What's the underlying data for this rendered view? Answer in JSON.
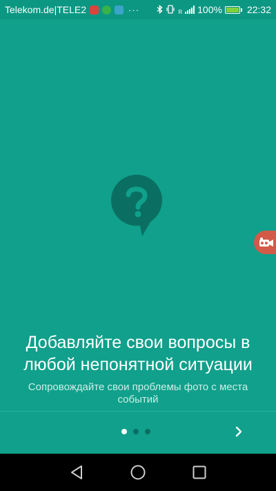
{
  "status_bar": {
    "carrier": "Telekom.de|TELE2",
    "more_indicator": "···",
    "battery_percent": "100%",
    "battery_level": 1.0,
    "time": "22:32",
    "network_type": "R"
  },
  "onboarding": {
    "title": "Добавляйте свои вопросы в любой непонятной ситуации",
    "subtitle": "Сопровождайте свои проблемы фото с места событий",
    "page_count": 3,
    "active_page": 1
  },
  "icons": {
    "hero": "question-bubble-icon",
    "next": "chevron-right-icon",
    "floating": "screen-recorder-icon",
    "nav_back": "triangle-back-icon",
    "nav_home": "circle-home-icon",
    "nav_recent": "square-recent-icon"
  },
  "colors": {
    "background": "#10a08b",
    "status_bar": "#0c9783",
    "icon_dark": "#0a6f62",
    "floating_bubble": "#d35a48",
    "battery_fill": "#7fd23a"
  }
}
